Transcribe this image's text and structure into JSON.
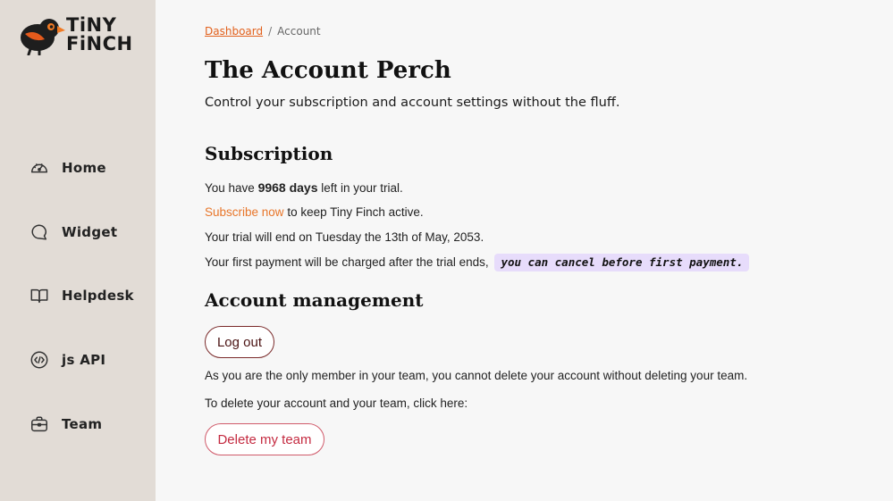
{
  "brand": {
    "name_line1": "TiNY",
    "name_line2": "FiNCH"
  },
  "sidebar": {
    "items": [
      {
        "label": "Home",
        "icon": "dashboard-gauge-icon"
      },
      {
        "label": "Widget",
        "icon": "chat-bubble-icon"
      },
      {
        "label": "Helpdesk",
        "icon": "open-book-icon"
      },
      {
        "label": "js API",
        "icon": "code-circle-icon"
      },
      {
        "label": "Team",
        "icon": "briefcase-icon"
      }
    ]
  },
  "breadcrumb": {
    "link": "Dashboard",
    "separator": "/",
    "current": "Account"
  },
  "page": {
    "title": "The Account Perch",
    "subtitle": "Control your subscription and account settings without the fluff."
  },
  "subscription": {
    "heading": "Subscription",
    "trial_prefix": "You have ",
    "trial_days": "9968 days",
    "trial_suffix": " left in your trial.",
    "subscribe_link": "Subscribe now",
    "subscribe_suffix": " to keep Tiny Finch active.",
    "trial_end": "Your trial will end on Tuesday the 13th of May, 2053.",
    "payment_text": "Your first payment will be charged after the trial ends,",
    "payment_highlight": "you can cancel before first payment."
  },
  "account": {
    "heading": "Account management",
    "logout_label": "Log out",
    "only_member_note": "As you are the only member in your team, you cannot delete your account without deleting your team.",
    "delete_prompt": "To delete your account and your team, click here:",
    "delete_label": "Delete my team"
  },
  "colors": {
    "accent": "#e2611d",
    "sidebar_bg": "#e2dcd6",
    "highlight_bg": "#e7dcfb",
    "danger": "#c42a40"
  }
}
